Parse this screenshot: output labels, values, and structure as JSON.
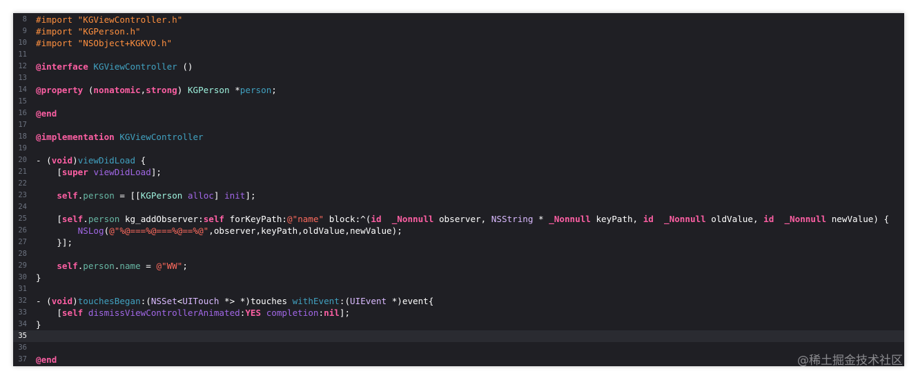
{
  "colors": {
    "background": "#1f1f24",
    "line_number": "#6c7380",
    "plain": "#ffffff",
    "keyword": "#fc5fa3",
    "preprocessor": "#fd8f3f",
    "string": "#fc6a5d",
    "type_project": "#9ef1dd",
    "type_system": "#dabaff",
    "method_system": "#a167e6",
    "other_decl": "#41a1c0",
    "project_member": "#67b7a4",
    "number": "#d0bf69"
  },
  "editor": {
    "current_line": "35",
    "lines": [
      {
        "num": "8",
        "tokens": [
          [
            "#import \"KGViewController.h\"",
            "preprocessor"
          ]
        ]
      },
      {
        "num": "9",
        "tokens": [
          [
            "#import \"KGPerson.h\"",
            "preprocessor"
          ]
        ]
      },
      {
        "num": "10",
        "tokens": [
          [
            "#import \"NSObject+KGKVO.h\"",
            "preprocessor"
          ]
        ]
      },
      {
        "num": "11",
        "tokens": []
      },
      {
        "num": "12",
        "tokens": [
          [
            "@interface",
            "keyword"
          ],
          [
            " ",
            "plain"
          ],
          [
            "KGViewController",
            "other_decl"
          ],
          [
            " ()",
            "plain"
          ]
        ]
      },
      {
        "num": "13",
        "tokens": []
      },
      {
        "num": "14",
        "tokens": [
          [
            "@property",
            "keyword"
          ],
          [
            " (",
            "plain"
          ],
          [
            "nonatomic",
            "keyword"
          ],
          [
            ",",
            "plain"
          ],
          [
            "strong",
            "keyword"
          ],
          [
            ") ",
            "plain"
          ],
          [
            "KGPerson",
            "type_project"
          ],
          [
            " *",
            "plain"
          ],
          [
            "person",
            "other_decl"
          ],
          [
            ";",
            "plain"
          ]
        ]
      },
      {
        "num": "15",
        "tokens": []
      },
      {
        "num": "16",
        "tokens": [
          [
            "@end",
            "keyword"
          ]
        ]
      },
      {
        "num": "17",
        "tokens": []
      },
      {
        "num": "18",
        "tokens": [
          [
            "@implementation",
            "keyword"
          ],
          [
            " ",
            "plain"
          ],
          [
            "KGViewController",
            "other_decl"
          ]
        ]
      },
      {
        "num": "19",
        "tokens": []
      },
      {
        "num": "20",
        "tokens": [
          [
            "- (",
            "plain"
          ],
          [
            "void",
            "keyword"
          ],
          [
            ")",
            "plain"
          ],
          [
            "viewDidLoad",
            "other_decl"
          ],
          [
            " {",
            "plain"
          ]
        ]
      },
      {
        "num": "21",
        "tokens": [
          [
            "    [",
            "plain"
          ],
          [
            "super",
            "keyword"
          ],
          [
            " ",
            "plain"
          ],
          [
            "viewDidLoad",
            "method_system"
          ],
          [
            "];",
            "plain"
          ]
        ]
      },
      {
        "num": "22",
        "tokens": []
      },
      {
        "num": "23",
        "tokens": [
          [
            "    ",
            "plain"
          ],
          [
            "self",
            "keyword"
          ],
          [
            ".",
            "plain"
          ],
          [
            "person",
            "project_member"
          ],
          [
            " = [[",
            "plain"
          ],
          [
            "KGPerson",
            "type_project"
          ],
          [
            " ",
            "plain"
          ],
          [
            "alloc",
            "method_system"
          ],
          [
            "] ",
            "plain"
          ],
          [
            "init",
            "method_system"
          ],
          [
            "];",
            "plain"
          ]
        ]
      },
      {
        "num": "24",
        "tokens": []
      },
      {
        "num": "25",
        "tokens": [
          [
            "    [",
            "plain"
          ],
          [
            "self",
            "keyword"
          ],
          [
            ".",
            "plain"
          ],
          [
            "person",
            "project_member"
          ],
          [
            " kg_addObserver:",
            "plain"
          ],
          [
            "self",
            "keyword"
          ],
          [
            " forKeyPath:",
            "plain"
          ],
          [
            "@\"name\"",
            "string"
          ],
          [
            " block:^(",
            "plain"
          ],
          [
            "id",
            "keyword"
          ],
          [
            "  ",
            "plain"
          ],
          [
            "_Nonnull",
            "keyword"
          ],
          [
            " observer, ",
            "plain"
          ],
          [
            "NSString",
            "type_system"
          ],
          [
            " * ",
            "plain"
          ],
          [
            "_Nonnull",
            "keyword"
          ],
          [
            " keyPath, ",
            "plain"
          ],
          [
            "id",
            "keyword"
          ],
          [
            "  ",
            "plain"
          ],
          [
            "_Nonnull",
            "keyword"
          ],
          [
            " oldValue, ",
            "plain"
          ],
          [
            "id",
            "keyword"
          ],
          [
            "  ",
            "plain"
          ],
          [
            "_Nonnull",
            "keyword"
          ],
          [
            " newValue) {",
            "plain"
          ]
        ]
      },
      {
        "num": "26",
        "tokens": [
          [
            "        ",
            "plain"
          ],
          [
            "NSLog",
            "method_system"
          ],
          [
            "(",
            "plain"
          ],
          [
            "@\"%@===%@===%@==%@\"",
            "string"
          ],
          [
            ",observer,keyPath,oldValue,newValue);",
            "plain"
          ]
        ]
      },
      {
        "num": "27",
        "tokens": [
          [
            "    }];",
            "plain"
          ]
        ]
      },
      {
        "num": "28",
        "tokens": []
      },
      {
        "num": "29",
        "tokens": [
          [
            "    ",
            "plain"
          ],
          [
            "self",
            "keyword"
          ],
          [
            ".",
            "plain"
          ],
          [
            "person",
            "project_member"
          ],
          [
            ".",
            "plain"
          ],
          [
            "name",
            "project_member"
          ],
          [
            " = ",
            "plain"
          ],
          [
            "@\"WW\"",
            "string"
          ],
          [
            ";",
            "plain"
          ]
        ]
      },
      {
        "num": "30",
        "tokens": [
          [
            "}",
            "plain"
          ]
        ]
      },
      {
        "num": "31",
        "tokens": []
      },
      {
        "num": "32",
        "tokens": [
          [
            "- (",
            "plain"
          ],
          [
            "void",
            "keyword"
          ],
          [
            ")",
            "plain"
          ],
          [
            "touchesBegan",
            "other_decl"
          ],
          [
            ":(",
            "plain"
          ],
          [
            "NSSet",
            "type_system"
          ],
          [
            "<",
            "plain"
          ],
          [
            "UITouch",
            "type_system"
          ],
          [
            " *> *)touches ",
            "plain"
          ],
          [
            "withEvent",
            "other_decl"
          ],
          [
            ":(",
            "plain"
          ],
          [
            "UIEvent",
            "type_system"
          ],
          [
            " *)event{",
            "plain"
          ]
        ]
      },
      {
        "num": "33",
        "tokens": [
          [
            "    [",
            "plain"
          ],
          [
            "self",
            "keyword"
          ],
          [
            " ",
            "plain"
          ],
          [
            "dismissViewControllerAnimated",
            "method_system"
          ],
          [
            ":",
            "plain"
          ],
          [
            "YES",
            "keyword"
          ],
          [
            " ",
            "plain"
          ],
          [
            "completion",
            "method_system"
          ],
          [
            ":",
            "plain"
          ],
          [
            "nil",
            "keyword"
          ],
          [
            "];",
            "plain"
          ]
        ]
      },
      {
        "num": "34",
        "tokens": [
          [
            "}",
            "plain"
          ]
        ]
      },
      {
        "num": "35",
        "tokens": []
      },
      {
        "num": "36",
        "tokens": []
      },
      {
        "num": "37",
        "tokens": [
          [
            "@end",
            "keyword"
          ]
        ]
      }
    ]
  },
  "watermark": "@稀土掘金技术社区"
}
